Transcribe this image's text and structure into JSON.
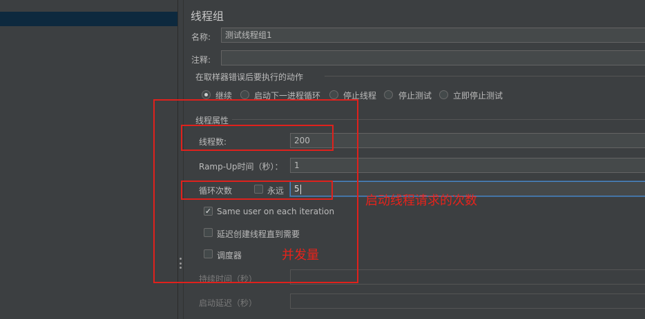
{
  "tree": {
    "selected_item": ""
  },
  "panel": {
    "title": "线程组",
    "name_label": "名称:",
    "name_value": "测试线程组1",
    "comment_label": "注释:",
    "comment_value": ""
  },
  "error_action": {
    "section_title": "在取样器错误后要执行的动作",
    "options": [
      "继续",
      "启动下一进程循环",
      "停止线程",
      "停止测试",
      "立即停止测试"
    ],
    "selected": "继续"
  },
  "thread_props": {
    "section_title": "线程属性",
    "threads_label": "线程数:",
    "threads_value": "200",
    "rampup_label": "Ramp-Up时间（秒）：",
    "rampup_value": "1",
    "loop_label": "循环次数",
    "forever_label": "永远",
    "forever_checked": false,
    "loop_value": "5",
    "same_user_label": "Same user on each iteration",
    "same_user_checked": true,
    "delay_label": "延迟创建线程直到需要",
    "delay_checked": false,
    "scheduler_label": "调度器",
    "scheduler_checked": false,
    "duration_label": "持续时间（秒）",
    "duration_value": "",
    "startup_delay_label": "启动延迟（秒）",
    "startup_delay_value": ""
  },
  "annotations": {
    "loop_note": "启动线程请求的次数",
    "concurrency_note": "并发量",
    "color": "#e8231b"
  }
}
